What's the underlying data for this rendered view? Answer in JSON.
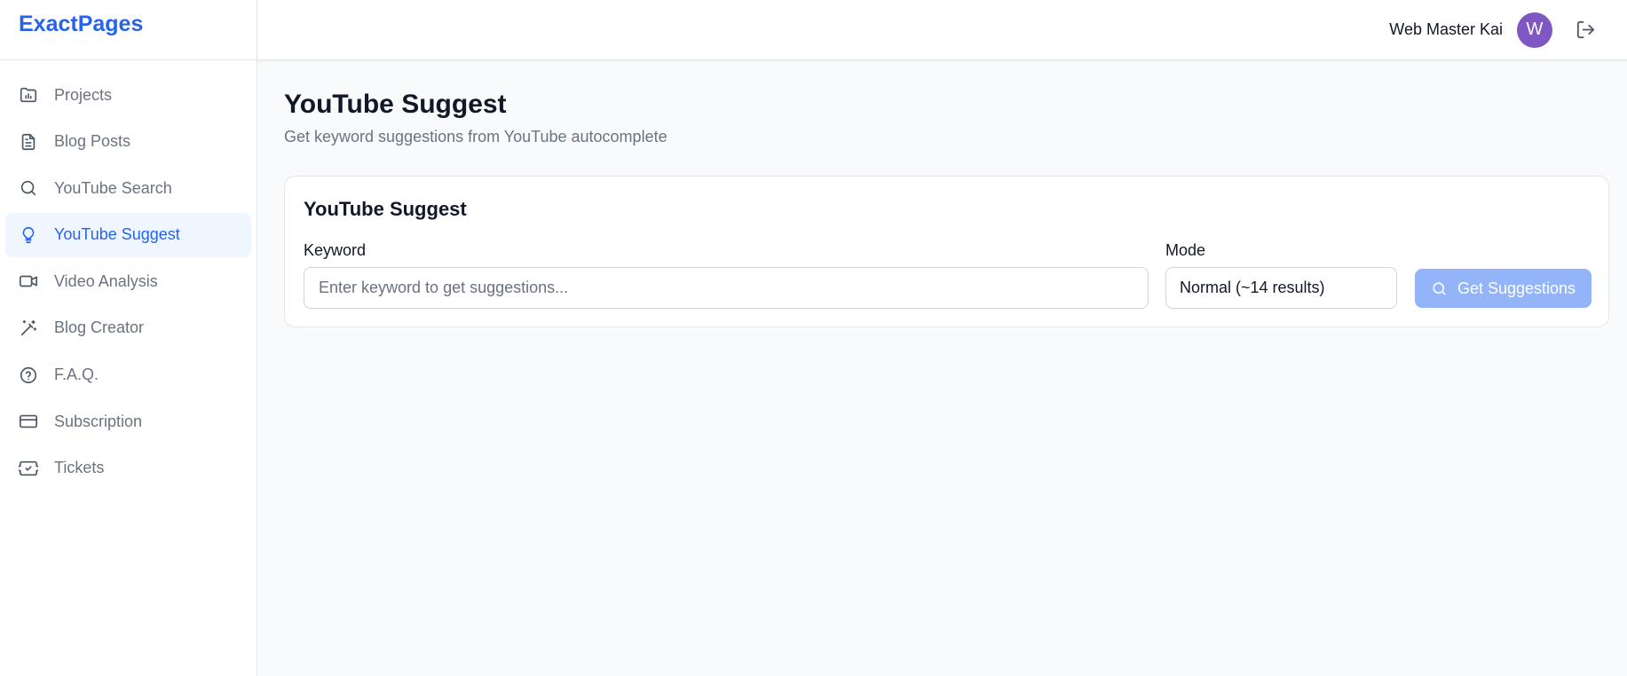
{
  "app": {
    "brand": "ExactPages",
    "accent_color": "#2563eb"
  },
  "sidebar": {
    "items": [
      {
        "label": "Projects",
        "icon": "folder-chart-icon",
        "active": false
      },
      {
        "label": "Blog Posts",
        "icon": "file-text-icon",
        "active": false
      },
      {
        "label": "YouTube Search",
        "icon": "search-icon",
        "active": false
      },
      {
        "label": "YouTube Suggest",
        "icon": "lightbulb-icon",
        "active": true
      },
      {
        "label": "Video Analysis",
        "icon": "video-camera-icon",
        "active": false
      },
      {
        "label": "Blog Creator",
        "icon": "magic-wand-icon",
        "active": false
      },
      {
        "label": "F.A.Q.",
        "icon": "help-circle-icon",
        "active": false
      },
      {
        "label": "Subscription",
        "icon": "credit-card-icon",
        "active": false
      },
      {
        "label": "Tickets",
        "icon": "ticket-icon",
        "active": false
      }
    ]
  },
  "header": {
    "user_name": "Web Master Kai",
    "avatar_initial": "W",
    "avatar_color": "#7e57c2",
    "logout_icon": "logout-icon"
  },
  "page": {
    "title": "YouTube Suggest",
    "subtitle": "Get keyword suggestions from YouTube autocomplete"
  },
  "card": {
    "title": "YouTube Suggest",
    "keyword_label": "Keyword",
    "keyword_value": "",
    "keyword_placeholder": "Enter keyword to get suggestions...",
    "mode_label": "Mode",
    "mode_selected": "Normal (~14 results)",
    "button_label": "Get Suggestions",
    "button_color": "#93b4f8"
  }
}
